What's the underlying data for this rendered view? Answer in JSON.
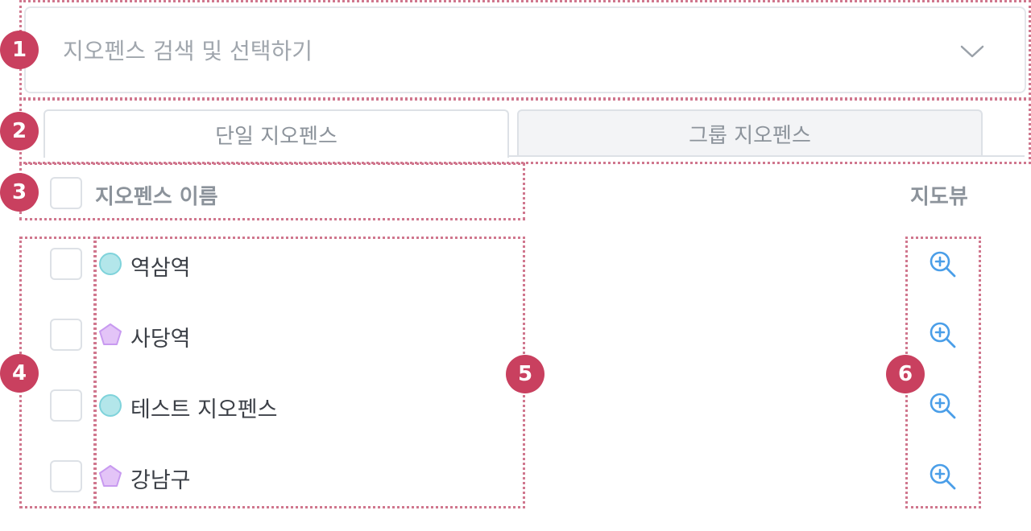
{
  "markers": [
    "1",
    "2",
    "3",
    "4",
    "5",
    "6"
  ],
  "search": {
    "placeholder": "지오펜스 검색 및 선택하기",
    "icon": "chevron-down-icon"
  },
  "tabs": [
    {
      "label": "단일 지오펜스",
      "active": true
    },
    {
      "label": "그룹 지오펜스",
      "active": false
    }
  ],
  "table": {
    "columns": {
      "name": "지오펜스 이름",
      "map_view": "지도뷰"
    },
    "rows": [
      {
        "name": "역삼역",
        "shape": "circle",
        "checked": false
      },
      {
        "name": "사당역",
        "shape": "polygon",
        "checked": false
      },
      {
        "name": "테스트 지오펜스",
        "shape": "circle",
        "checked": false
      },
      {
        "name": "강남구",
        "shape": "polygon",
        "checked": false
      }
    ]
  },
  "colors": {
    "marker": "#c9405f",
    "annotation": "#d0778e",
    "circle_fill": "#b3e6ea",
    "circle_stroke": "#7fd3db",
    "polygon_fill": "#e3c4f7",
    "polygon_stroke": "#c89af0",
    "zoom_icon": "#4a9ee8"
  }
}
